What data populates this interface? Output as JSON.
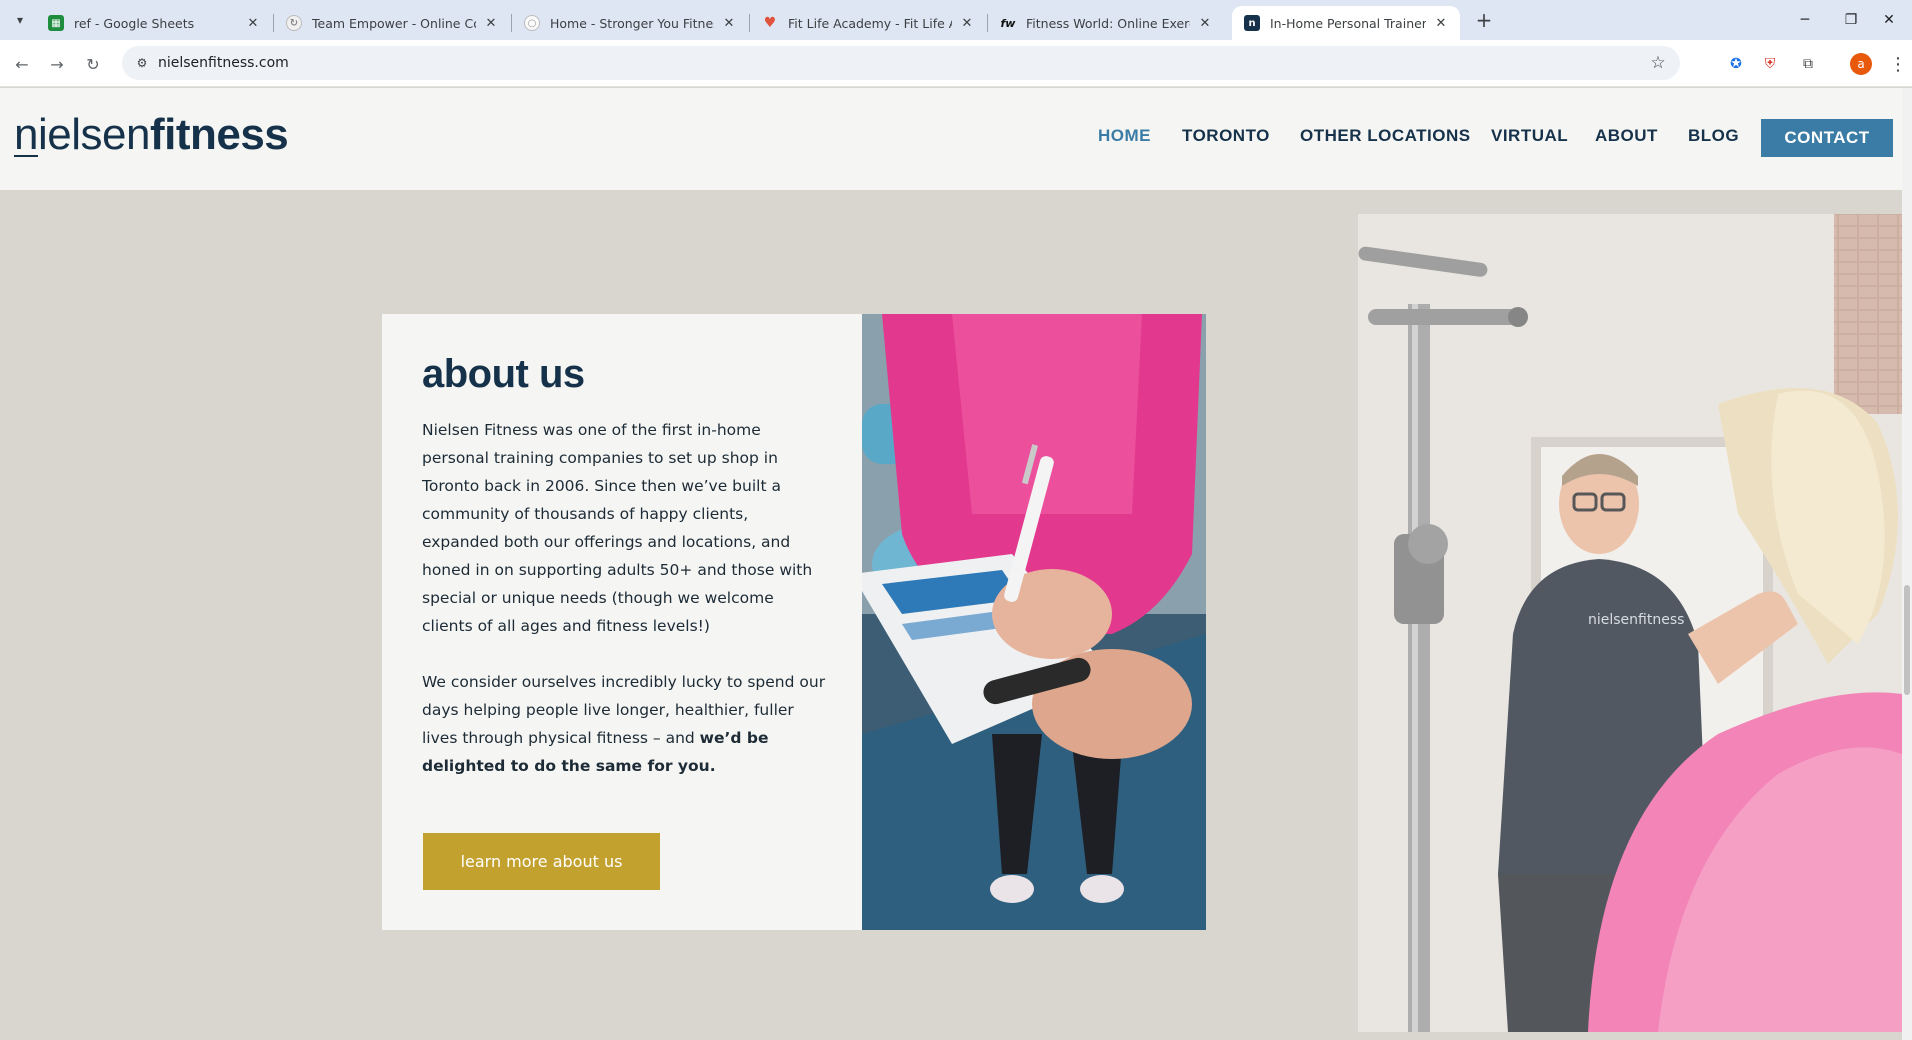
{
  "browser": {
    "tabs": [
      {
        "title": "ref - Google Sheets",
        "icon": "sheets-icon"
      },
      {
        "title": "Team Empower - Online Coachi",
        "icon": "team-empower-icon"
      },
      {
        "title": "Home - Stronger You Fitness",
        "icon": "stronger-you-icon"
      },
      {
        "title": "Fit Life Academy - Fit Life Acad",
        "icon": "fit-life-icon"
      },
      {
        "title": "Fitness World: Online Exercise C",
        "icon": "fitness-world-icon"
      },
      {
        "title": "In-Home Personal Trainer | Niel",
        "icon": "nielsen-icon"
      }
    ],
    "active_tab": 5,
    "url": "nielsenfitness.com",
    "profile_initial": "a"
  },
  "site": {
    "logo": {
      "part1": "n",
      "part2": "ielsen",
      "part3": "fitness"
    },
    "nav": [
      {
        "label": "HOME",
        "active": true
      },
      {
        "label": "TORONTO",
        "active": false
      },
      {
        "label": "OTHER LOCATIONS",
        "active": false
      },
      {
        "label": "VIRTUAL",
        "active": false
      },
      {
        "label": "ABOUT",
        "active": false
      },
      {
        "label": "BLOG",
        "active": false
      }
    ],
    "contact_label": "CONTACT",
    "about": {
      "title": "about us",
      "paragraph1": "Nielsen Fitness was one of the first in-home personal training companies to set up shop in Toronto back in 2006. Since then we’ve built a community of thousands of happy clients, expanded both our offerings and locations, and honed in on supporting adults 50+ and those with special or unique needs (though we welcome clients of all ages and fitness levels!)",
      "paragraph2_start": "We consider ourselves incredibly lucky to spend our days helping people live longer, healthier, fuller lives through physical fitness – and ",
      "paragraph2_bold": "we’d be delighted to do the same for you.",
      "button_label": "learn more about us"
    },
    "photo2_shirt_text": "nielsenfitness"
  },
  "colors": {
    "brand_navy": "#16324a",
    "brand_blue": "#3a7ca5",
    "gold": "#c3a12f",
    "page_bg": "#d9d6d0",
    "card_bg": "#f5f5f3"
  }
}
